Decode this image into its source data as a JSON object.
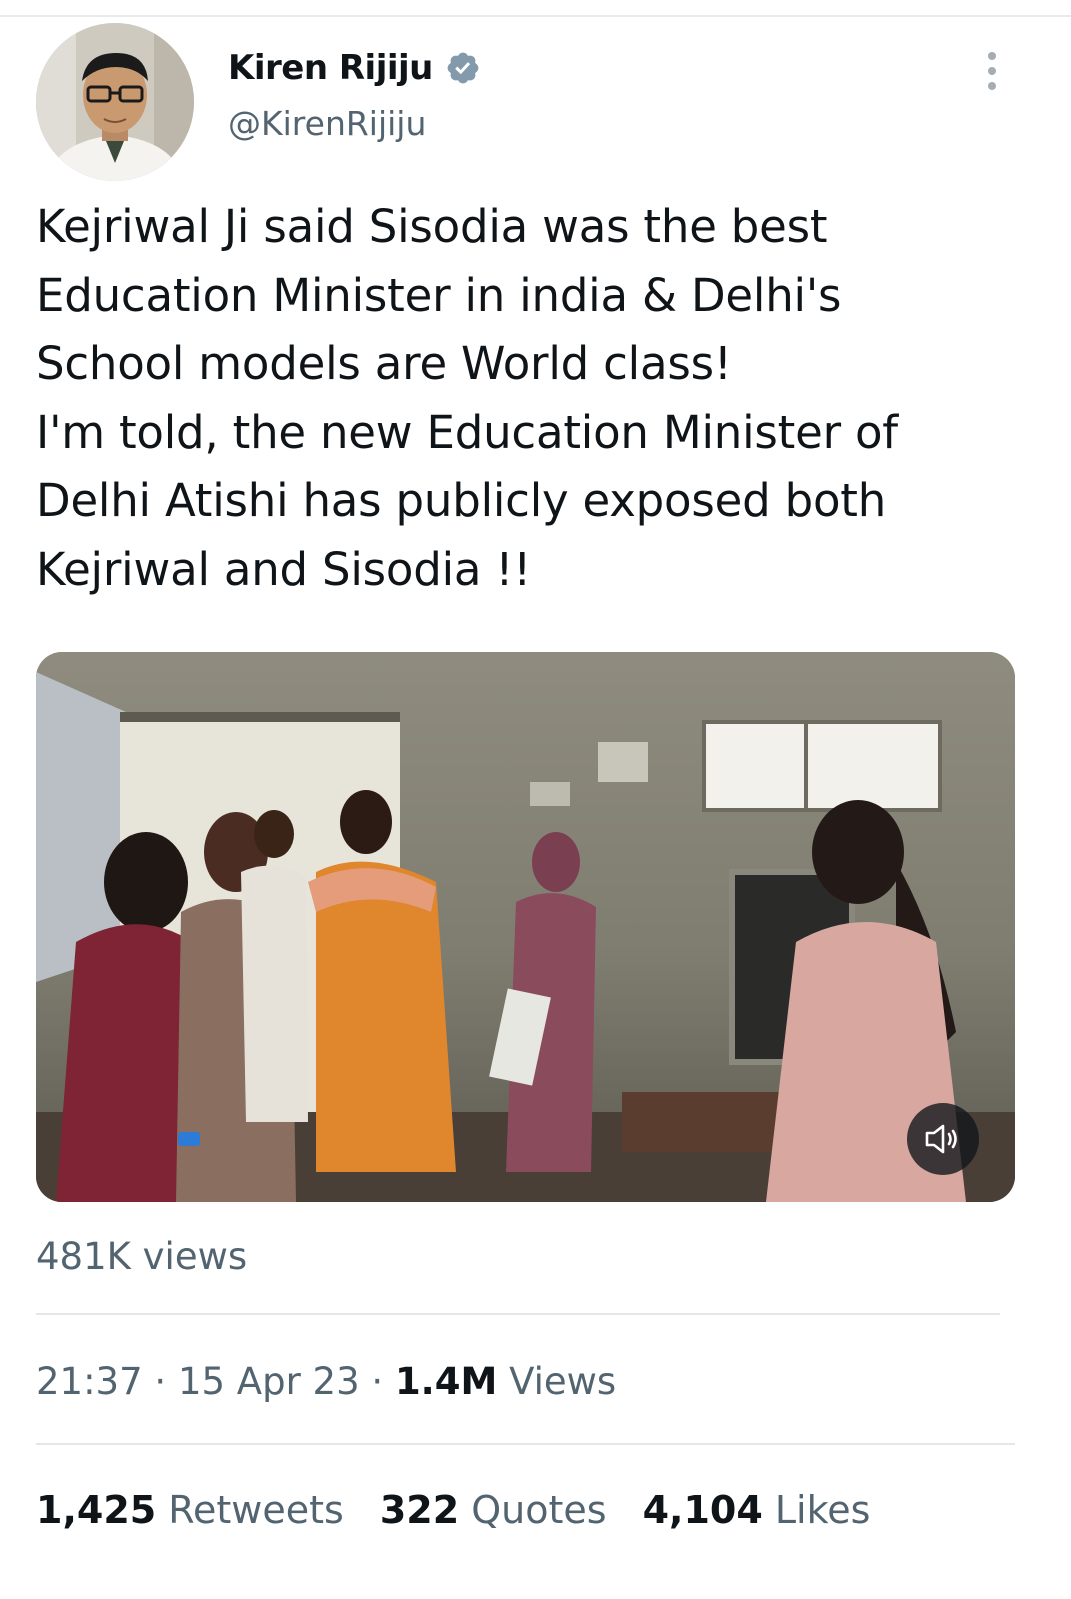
{
  "author": {
    "display_name": "Kiren Rijiju",
    "handle": "@KirenRijiju",
    "verified_icon": "verified-badge-icon",
    "avatar_icon": "profile-photo"
  },
  "tweet": {
    "lines": [
      "Kejriwal Ji said Sisodia was the best",
      "Education Minister in india & Delhi's",
      "School models are World class!",
      "I'm told, the new Education Minister of",
      "Delhi Atishi has publicly exposed both",
      "Kejriwal and Sisodia !!"
    ]
  },
  "media": {
    "type": "video",
    "mute_icon": "speaker-muted-icon"
  },
  "video_views": "481K views",
  "meta": {
    "time": "21:37",
    "separator": "·",
    "date": "15 Apr 23",
    "views_count": "1.4M",
    "views_label": "Views"
  },
  "stats": {
    "retweets_count": "1,425",
    "retweets_label": "Retweets",
    "quotes_count": "322",
    "quotes_label": "Quotes",
    "likes_count": "4,104",
    "likes_label": "Likes"
  },
  "colors": {
    "text_primary": "#0f1419",
    "text_secondary": "#536471",
    "verified": "#829aab",
    "divider": "#e4e6e8"
  }
}
